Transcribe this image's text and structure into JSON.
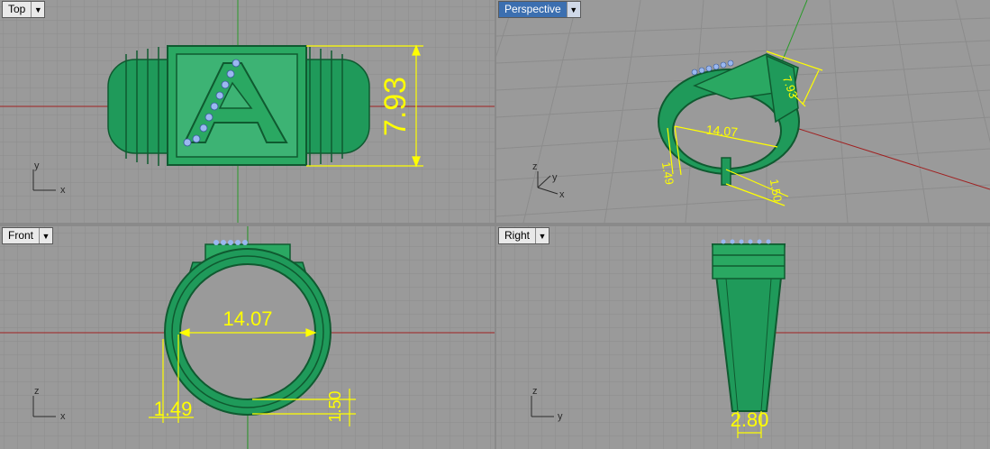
{
  "viewports": {
    "top": {
      "label": "Top"
    },
    "perspective": {
      "label": "Perspective"
    },
    "front": {
      "label": "Front"
    },
    "right": {
      "label": "Right"
    }
  },
  "dimensions": {
    "top_height": "7.93",
    "persp_height": "7.93",
    "persp_diameter": "14.07",
    "persp_thickness": "1.49",
    "persp_gap": "1.50",
    "front_diameter": "14.07",
    "front_thickness": "1.49",
    "front_gap": "1.50",
    "right_width": "2.80"
  },
  "ring_letter": "A",
  "axes": {
    "x": "x",
    "y": "y",
    "z": "z"
  },
  "colors": {
    "ring": "#1f9a5a",
    "ring_dark": "#0f6b3a",
    "dimension": "#ffff00",
    "gems": "#9ab8f0",
    "grid": "#8c8c8c",
    "bg": "#9a9a9a",
    "x_axis": "#a02020",
    "y_axis": "#2a9a2a"
  }
}
